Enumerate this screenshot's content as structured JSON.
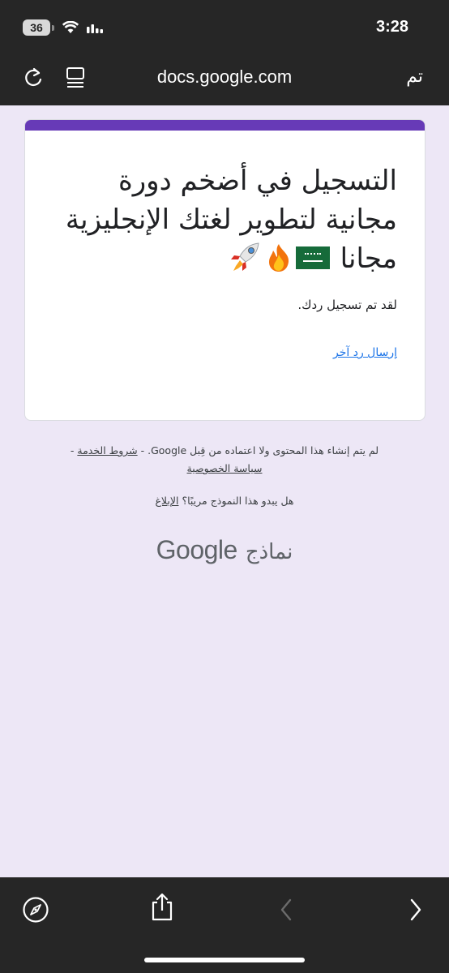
{
  "status_bar": {
    "battery": "36",
    "time": "3:28"
  },
  "browser": {
    "url": "docs.google.com",
    "done_label": "تم"
  },
  "form": {
    "title": "التسجيل في أضخم دورة مجانية لتطوير لغتك الإنجليزية مجانا",
    "title_emojis": [
      "saudi-flag",
      "fire",
      "rocket"
    ],
    "accent_color": "#673ab7",
    "confirmation": "لقد تم تسجيل ردك.",
    "submit_another_link": "إرسال رد آخر"
  },
  "footer": {
    "disclaimer_text": "لم يتم إنشاء هذا المحتوى ولا اعتماده من قِبل Google. -",
    "terms_link": "شروط الخدمة",
    "separator": "-",
    "privacy_link": "سياسة الخصوصية",
    "report_question": "هل يبدو هذا النموذج مريبًا؟",
    "report_link": "الإبلاغ",
    "brand_google": "Google",
    "brand_forms": "نماذج"
  }
}
